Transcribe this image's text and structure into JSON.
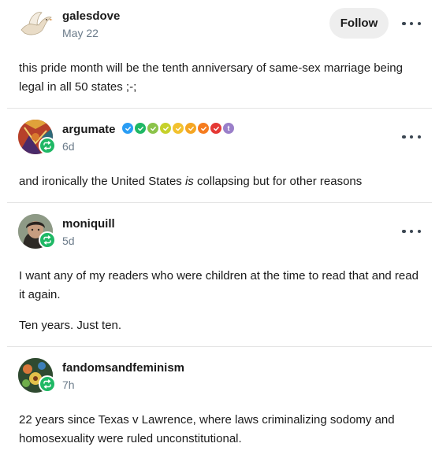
{
  "posts": [
    {
      "username": "galesdove",
      "timestamp": "May 22",
      "follow_label": "Follow",
      "paragraphs": [
        "this pride month will be the tenth anniversary of same-sex marriage being legal in all 50 states ;-;"
      ]
    },
    {
      "username": "argumate",
      "timestamp": "6d",
      "badge_colors": [
        "#2a9df4",
        "#1fb865",
        "#8bc34a",
        "#c6d12b",
        "#f2c12e",
        "#f5a623",
        "#f57c1f",
        "#e53935"
      ],
      "badge_tumblr_letter": "t",
      "paragraph_pre": "and ironically the United States ",
      "paragraph_em": "is",
      "paragraph_post": " collapsing but for other reasons"
    },
    {
      "username": "moniquill",
      "timestamp": "5d",
      "paragraphs": [
        "I want any of my readers who were children at the time to read that and read it again.",
        "Ten years. Just ten."
      ]
    },
    {
      "username": "fandomsandfeminism",
      "timestamp": "7h",
      "paragraphs": [
        "22 years since Texas v Lawrence, where laws criminalizing sodomy and homosexuality were ruled unconstitutional."
      ]
    }
  ],
  "icons": {
    "more": "more-options-icon",
    "reblog": "reblog-icon",
    "verified": "checkmark-badge-icon"
  },
  "colors": {
    "reblog_green": "#1fb865",
    "timestamp_gray": "#6b7b8a"
  }
}
